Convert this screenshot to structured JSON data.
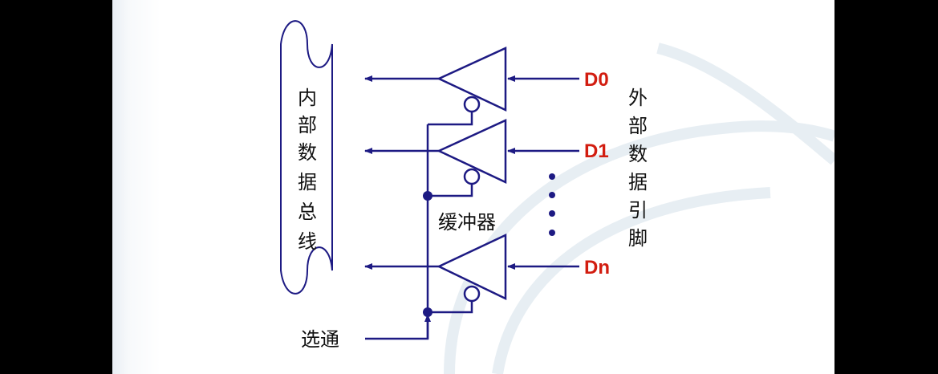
{
  "diagram": {
    "bus_label_chars": [
      "内",
      "部",
      "数",
      "据",
      "总",
      "线"
    ],
    "external_label_chars": [
      "外",
      "部",
      "数",
      "据",
      "引",
      "脚"
    ],
    "buffer_label": "缓冲器",
    "strobe_label": "选通",
    "pins": [
      "D0",
      "D1",
      "Dn"
    ],
    "line_color": "#1d1a83",
    "pin_color": "#d21d10"
  }
}
